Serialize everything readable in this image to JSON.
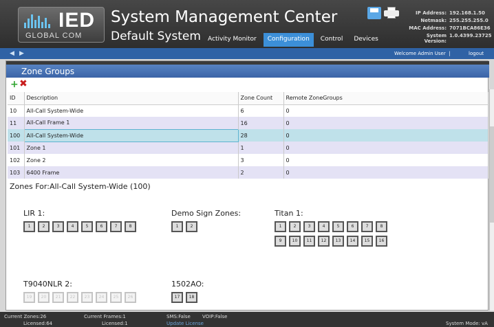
{
  "header": {
    "logo_brand": "IED",
    "logo_sub": "GLOBAL COM",
    "title": "System Management Center",
    "system_name": "Default System",
    "nav": [
      {
        "label": "Activity Monitor",
        "active": false
      },
      {
        "label": "Configuration",
        "active": true
      },
      {
        "label": "Control",
        "active": false
      },
      {
        "label": "Devices",
        "active": false
      }
    ],
    "sysinfo": [
      {
        "label": "IP Address:",
        "value": "192.168.1.50"
      },
      {
        "label": "Netmask:",
        "value": "255.255.255.0"
      },
      {
        "label": "MAC Address:",
        "value": "7071BCA86E36"
      },
      {
        "label": "System Version:",
        "value": "1.0.4399.23725"
      }
    ],
    "icons": {
      "save": "save-icon",
      "print": "print-icon"
    }
  },
  "subheader": {
    "back": "◀",
    "forward": "▶",
    "welcome": "Welcome Admin User",
    "separator": "|",
    "logout": "logout"
  },
  "panel": {
    "title": "Zone Groups",
    "add_icon": "+",
    "delete_icon": "✖",
    "columns": [
      "ID",
      "Description",
      "Zone Count",
      "Remote ZoneGroups"
    ],
    "rows": [
      {
        "id": "10",
        "description": "All-Call System-Wide",
        "zone_count": "6",
        "remote": "0"
      },
      {
        "id": "11",
        "description": "All-Call Frame 1",
        "zone_count": "16",
        "remote": "0"
      },
      {
        "id": "100",
        "description": "All-Call System-Wide",
        "zone_count": "28",
        "remote": "0",
        "selected": true
      },
      {
        "id": "101",
        "description": "Zone 1",
        "zone_count": "1",
        "remote": "0"
      },
      {
        "id": "102",
        "description": "Zone 2",
        "zone_count": "3",
        "remote": "0"
      },
      {
        "id": "103",
        "description": "6400 Frame",
        "zone_count": "2",
        "remote": "0"
      }
    ],
    "zones_for_label": "Zones For:",
    "zones_for_value": "All-Call System-Wide (100)"
  },
  "zone_groups": [
    {
      "name": "LIR 1:",
      "rows": [
        [
          "1",
          "2",
          "3",
          "4",
          "5",
          "6",
          "7",
          "8"
        ]
      ],
      "dim": false
    },
    {
      "name": "Demo Sign Zones:",
      "rows": [
        [
          "1",
          "2"
        ]
      ],
      "dim": false
    },
    {
      "name": "Titan 1:",
      "rows": [
        [
          "1",
          "2",
          "3",
          "4",
          "5",
          "6",
          "7",
          "8"
        ],
        [
          "9",
          "10",
          "11",
          "12",
          "13",
          "14",
          "15",
          "16"
        ]
      ],
      "dim": false
    },
    {
      "name": "T9040NLR 2:",
      "rows": [
        [
          "19",
          "20",
          "21",
          "22",
          "23",
          "24",
          "25",
          "26"
        ]
      ],
      "dim": true
    },
    {
      "name": "1502AO:",
      "rows": [
        [
          "17",
          "18"
        ]
      ],
      "dim": false
    }
  ],
  "footer": {
    "current_zones": "Current Zones:26",
    "licensed_zones": "Licensed:64",
    "current_frames": "Current Frames:1",
    "licensed_frames": "Licensed:1",
    "sms": "SMS:False",
    "voip": "VOIP:False",
    "update_license": "Update License",
    "system_mode": "System Mode: vA"
  }
}
